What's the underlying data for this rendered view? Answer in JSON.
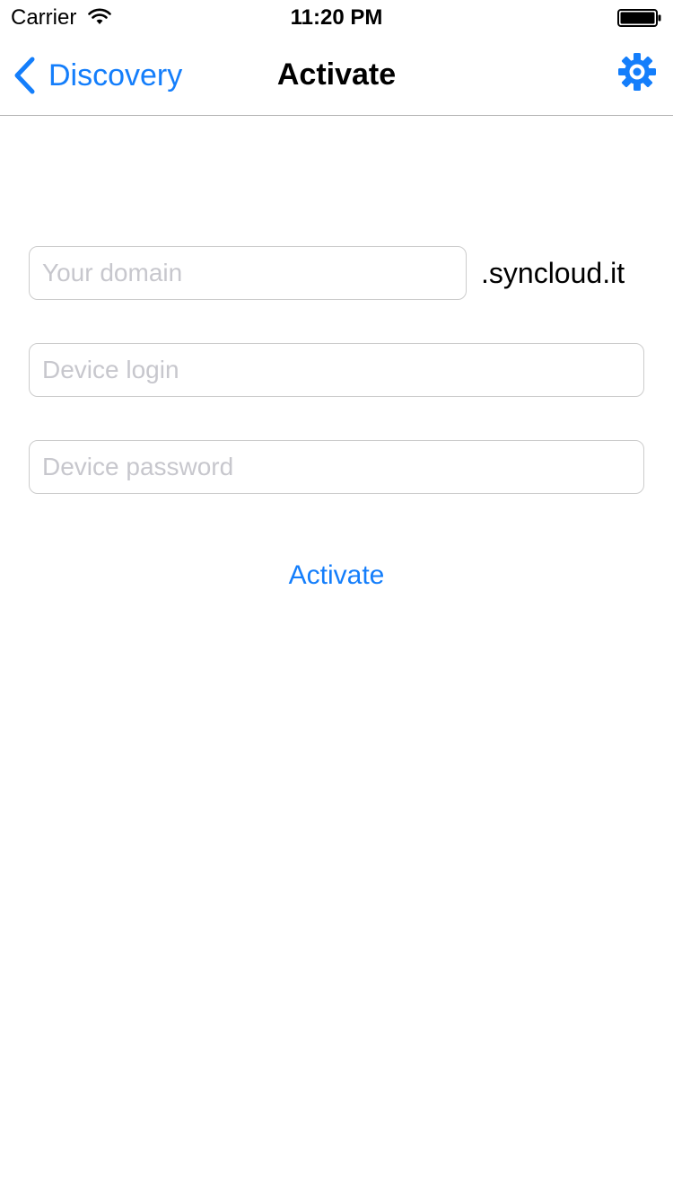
{
  "status_bar": {
    "carrier": "Carrier",
    "time": "11:20 PM"
  },
  "nav_bar": {
    "back_label": "Discovery",
    "title": "Activate",
    "settings_icon": "gear-icon"
  },
  "form": {
    "domain_placeholder": "Your domain",
    "domain_value": "",
    "domain_suffix": ".syncloud.it",
    "login_placeholder": "Device login",
    "login_value": "",
    "password_placeholder": "Device password",
    "password_value": "",
    "activate_label": "Activate"
  },
  "colors": {
    "accent": "#147efb",
    "placeholder": "#c7c7cd",
    "field_border": "#cccccc",
    "separator": "#b2b2b2"
  }
}
